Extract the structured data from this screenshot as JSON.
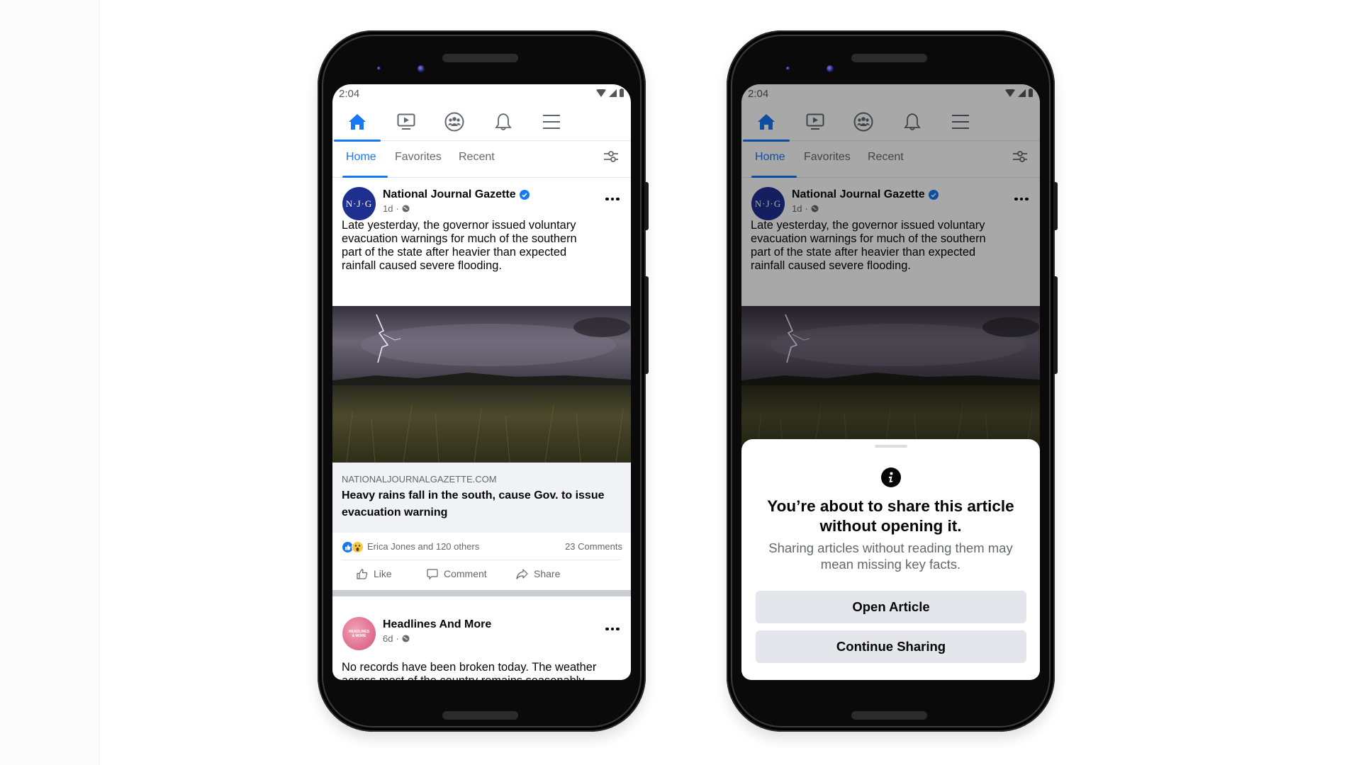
{
  "status_bar": {
    "time": "2:04"
  },
  "nav": {
    "items": [
      {
        "icon": "home-icon",
        "active": true
      },
      {
        "icon": "watch-icon",
        "active": false
      },
      {
        "icon": "groups-icon",
        "active": false
      },
      {
        "icon": "notifications-icon",
        "active": false
      },
      {
        "icon": "menu-icon",
        "active": false
      }
    ],
    "accent_color": "#1877f2"
  },
  "subtabs": {
    "items": [
      {
        "label": "Home",
        "active": true
      },
      {
        "label": "Favorites",
        "active": false
      },
      {
        "label": "Recent",
        "active": false
      }
    ],
    "filter_icon": "filter-sliders-icon"
  },
  "post1": {
    "avatar_text": "N·J·G",
    "author": "National Journal Gazette",
    "verified": true,
    "time": "1d",
    "audience_icon": "globe-icon",
    "text": "Late yesterday, the governor issued voluntary evacuation warnings for much of the southern part of the state after heavier than expected rainfall caused severe flooding.",
    "text_lines": [
      "Late yesterday, the governor issued voluntary",
      "evacuation warnings for much of the southern",
      "part of the state after heavier than expected",
      "rainfall caused severe flooding."
    ],
    "image_description": "lightning storm over a grass field",
    "link": {
      "domain": "NATIONALJOURNALGAZETTE.COM",
      "title_lines": [
        "Heavy rains fall in the south, cause Gov. to issue",
        "evacuation warning"
      ]
    },
    "reactions": {
      "icons": [
        "like",
        "wow"
      ],
      "text": "Erica Jones and 120 others"
    },
    "comments": "23 Comments",
    "actions": {
      "like": "Like",
      "comment": "Comment",
      "share": "Share"
    }
  },
  "post2": {
    "avatar_text": "HEADLINES & MORE",
    "author": "Headlines And More",
    "time": "6d",
    "audience_icon": "globe-icon",
    "text_line1": "No records have been broken today. The weather",
    "text_line2": "across most of the country remains seasonably"
  },
  "share_prompt": {
    "icon": "info-icon",
    "title_lines": [
      "You’re about to share this article",
      "without opening it."
    ],
    "subtitle_lines": [
      "Sharing articles without reading them may",
      "mean missing key facts."
    ],
    "open_button": "Open Article",
    "continue_button": "Continue Sharing"
  }
}
